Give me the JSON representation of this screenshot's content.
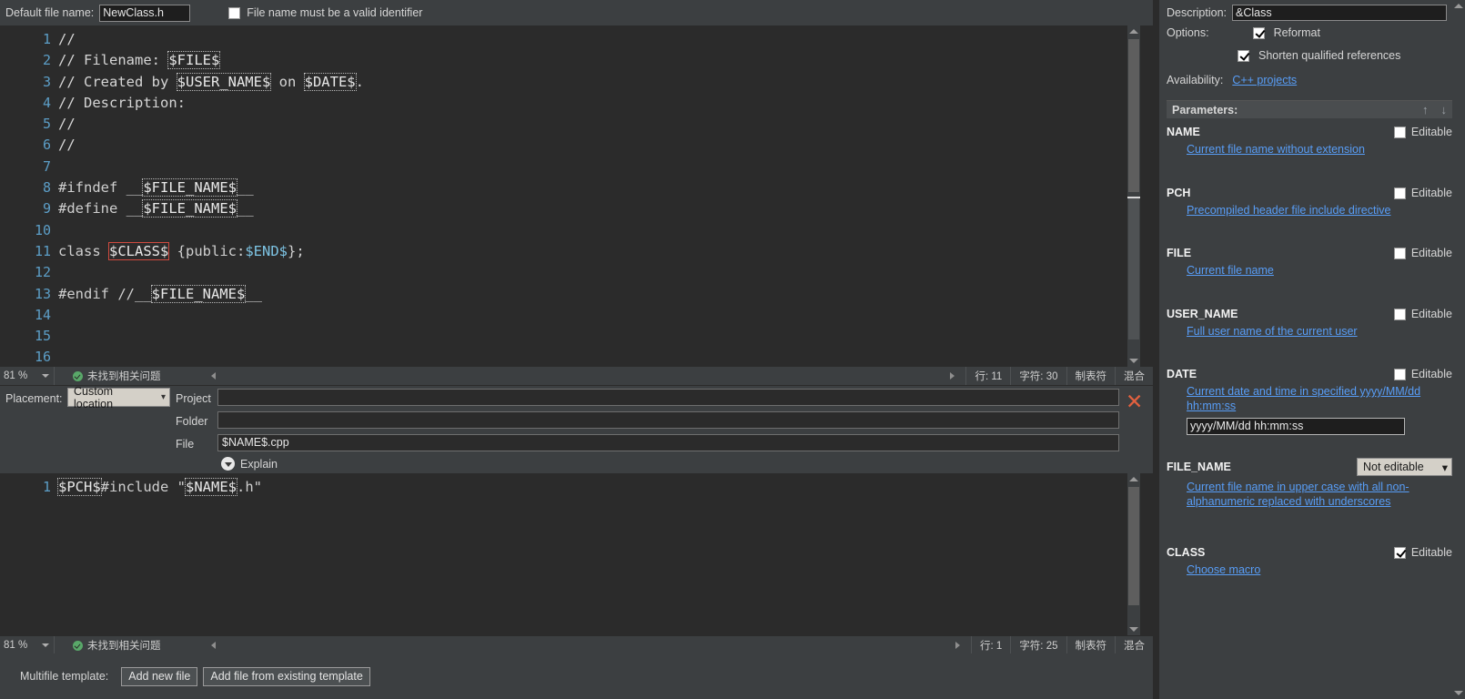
{
  "topbar": {
    "default_file_name_label": "Default file name:",
    "default_file_name_value": "NewClass.h",
    "valid_identifier_label": "File name must be a valid identifier",
    "valid_identifier_checked": false
  },
  "editor1": {
    "lines": [
      {
        "num": "1",
        "segments": [
          {
            "t": "//",
            "k": "cmt"
          }
        ]
      },
      {
        "num": "2",
        "segments": [
          {
            "t": "// Filename: ",
            "k": "cmt"
          },
          {
            "t": "$FILE$",
            "k": "var"
          }
        ]
      },
      {
        "num": "3",
        "segments": [
          {
            "t": "// Created by ",
            "k": "cmt"
          },
          {
            "t": "$USER_NAME$",
            "k": "var"
          },
          {
            "t": " on ",
            "k": "cmt"
          },
          {
            "t": "$DATE$",
            "k": "var"
          },
          {
            "t": ".",
            "k": "cmt"
          }
        ]
      },
      {
        "num": "4",
        "segments": [
          {
            "t": "// Description:",
            "k": "cmt"
          }
        ]
      },
      {
        "num": "5",
        "segments": [
          {
            "t": "//",
            "k": "cmt"
          }
        ]
      },
      {
        "num": "6",
        "segments": [
          {
            "t": "//",
            "k": "cmt"
          }
        ]
      },
      {
        "num": "7",
        "segments": [
          {
            "t": "",
            "k": "cmt"
          }
        ]
      },
      {
        "num": "8",
        "segments": [
          {
            "t": "#ifndef __",
            "k": "kw"
          },
          {
            "t": "$FILE_NAME$",
            "k": "var"
          },
          {
            "t": "__",
            "k": "kw"
          }
        ]
      },
      {
        "num": "9",
        "segments": [
          {
            "t": "#define __",
            "k": "kw"
          },
          {
            "t": "$FILE_NAME$",
            "k": "var"
          },
          {
            "t": "__",
            "k": "kw"
          }
        ]
      },
      {
        "num": "10",
        "segments": [
          {
            "t": "",
            "k": "kw"
          }
        ]
      },
      {
        "num": "11",
        "segments": [
          {
            "t": "class ",
            "k": "kw"
          },
          {
            "t": "$CLASS$",
            "k": "var-sel"
          },
          {
            "t": " {public:",
            "k": "kw"
          },
          {
            "t": "$END$",
            "k": "tok-blue"
          },
          {
            "t": "};",
            "k": "kw"
          }
        ]
      },
      {
        "num": "12",
        "segments": [
          {
            "t": "",
            "k": "kw"
          }
        ]
      },
      {
        "num": "13",
        "segments": [
          {
            "t": "#endif //__",
            "k": "kw"
          },
          {
            "t": "$FILE_NAME$",
            "k": "var"
          },
          {
            "t": "__",
            "k": "kw"
          }
        ]
      },
      {
        "num": "14",
        "segments": [
          {
            "t": "",
            "k": "kw"
          }
        ]
      },
      {
        "num": "15",
        "segments": [
          {
            "t": "",
            "k": "kw"
          }
        ]
      },
      {
        "num": "16",
        "segments": [
          {
            "t": "",
            "k": "kw"
          }
        ]
      }
    ]
  },
  "statusbar1": {
    "zoom": "81 %",
    "problems": "未找到相关问题",
    "line": "行: 11",
    "chars": "字符: 30",
    "tabs": "制表符",
    "mixed": "混合"
  },
  "placement": {
    "placement_label": "Placement:",
    "placement_value": "Custom location",
    "project_label": "Project",
    "project_value": "",
    "folder_label": "Folder",
    "folder_value": "",
    "file_label": "File",
    "file_value": "$NAME$.cpp",
    "explain_label": "Explain",
    "delete_icon": "close-x"
  },
  "editor2": {
    "lines": [
      {
        "num": "1",
        "segments": [
          {
            "t": "$PCH$",
            "k": "var"
          },
          {
            "t": "#include \"",
            "k": "kw"
          },
          {
            "t": "$NAME$",
            "k": "var"
          },
          {
            "t": ".h\"",
            "k": "kw"
          }
        ]
      }
    ]
  },
  "statusbar2": {
    "zoom": "81 %",
    "problems": "未找到相关问题",
    "line": "行: 1",
    "chars": "字符: 25",
    "tabs": "制表符",
    "mixed": "混合"
  },
  "multifile": {
    "label": "Multifile template:",
    "add_new_file": "Add new file",
    "add_from_existing": "Add file from existing template"
  },
  "rightpanel": {
    "description_label": "Description:",
    "description_value": "&Class",
    "options_label": "Options:",
    "reformat_label": "Reformat",
    "reformat_checked": true,
    "shorten_label": "Shorten qualified references",
    "shorten_checked": true,
    "availability_label": "Availability:",
    "availability_value": "C++ projects",
    "parameters_label": "Parameters:",
    "move_up_icon": "arrow-up-icon",
    "move_down_icon": "arrow-down-icon",
    "editable_label": "Editable",
    "parameters": [
      {
        "name": "NAME",
        "description": "Current file name without extension",
        "editable": false,
        "control": "checkbox"
      },
      {
        "name": "PCH",
        "description": "Precompiled header file include directive",
        "editable": false,
        "control": "checkbox"
      },
      {
        "name": "FILE",
        "description": "Current file name",
        "editable": false,
        "control": "checkbox"
      },
      {
        "name": "USER_NAME",
        "description": "Full user name of the current user",
        "editable": false,
        "control": "checkbox"
      },
      {
        "name": "DATE",
        "description": "Current date and time in specified yyyy/MM/dd hh:mm:ss",
        "editable": false,
        "control": "checkbox",
        "input_value": "yyyy/MM/dd hh:mm:ss"
      },
      {
        "name": "FILE_NAME",
        "description": "Current file name in upper case with all non-alphanumeric replaced with underscores",
        "control": "combo",
        "combo_value": "Not editable"
      },
      {
        "name": "CLASS",
        "description": "Choose macro",
        "editable": true,
        "control": "checkbox"
      }
    ]
  }
}
